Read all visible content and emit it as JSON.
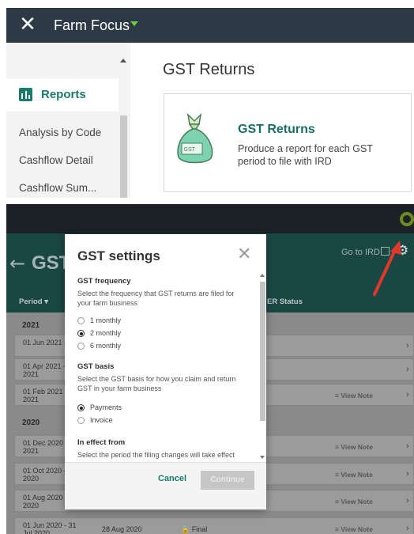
{
  "top": {
    "app_name": "Farm Focus",
    "sidebar": {
      "reports_label": "Reports",
      "items": [
        "Analysis by Code",
        "Cashflow Detail",
        "Cashflow Sum..."
      ]
    },
    "main_title": "GST Returns",
    "card": {
      "title": "GST Returns",
      "description": "Produce a report for each GST period to file with IRD",
      "icon_text": "GST"
    }
  },
  "bottom": {
    "header": {
      "title": "GST",
      "goto_ird": "Go to IRD",
      "col_period": "Period ▾",
      "col_status": "ER Status"
    },
    "years": [
      "2021",
      "2020"
    ],
    "rows": [
      {
        "period": "01 Jun 2021 -",
        "due": "",
        "status": "",
        "note": "",
        "group": 0
      },
      {
        "period": "01 Apr 2021 - 2021",
        "due": "",
        "status": "",
        "note": "",
        "group": 0
      },
      {
        "period": "01 Feb 2021 - 2021",
        "due": "",
        "status": "",
        "note": "View Note",
        "group": 0
      },
      {
        "period": "01 Dec 2020 - 2021",
        "due": "",
        "status": "",
        "note": "View Note",
        "group": 1
      },
      {
        "period": "01 Oct 2020 - 2020",
        "due": "",
        "status": "",
        "note": "View Note",
        "group": 1
      },
      {
        "period": "01 Aug 2020 - 2020",
        "due": "",
        "status": "",
        "note": "View Note",
        "group": 1
      },
      {
        "period": "01 Jun 2020 - 31 Jul 2020",
        "due": "28 Aug 2020",
        "status": "Final",
        "note": "View Note",
        "group": 1
      }
    ]
  },
  "dialog": {
    "title": "GST settings",
    "frequency": {
      "heading": "GST frequency",
      "description": "Select the frequency that GST returns are filed for your farm business",
      "options": [
        "1 monthly",
        "2 monthly",
        "6 monthly"
      ],
      "selected": "2 monthly"
    },
    "basis": {
      "heading": "GST basis",
      "description": "Select the GST basis for how you claim and return GST in your farm business",
      "options": [
        "Payments",
        "Invoice"
      ],
      "selected": "Payments"
    },
    "effect": {
      "heading": "In effect from",
      "description": "Select the period the filing changes will take effect"
    },
    "cancel_label": "Cancel",
    "continue_label": "Continue"
  },
  "colors": {
    "topbar": "#2d3a45",
    "accent_green": "#6fcf3a",
    "teal": "#1a7a6c",
    "header_teal": "#1a4744",
    "arrow_red": "#e0392b"
  }
}
